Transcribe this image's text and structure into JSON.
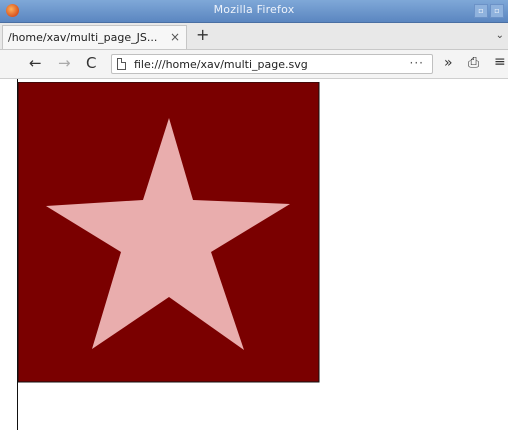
{
  "window": {
    "title": "Mozilla Firefox",
    "controls": [
      "▫",
      "▫"
    ]
  },
  "tabs": [
    {
      "label": "/home/xav/multi_page_JS...",
      "close": "×",
      "active": true
    }
  ],
  "tabstrip": {
    "new_tab": "+",
    "overflow": "⌄"
  },
  "navbar": {
    "back": "←",
    "forward": "→",
    "reload": "C",
    "url": "file:///home/xav/multi_page.svg",
    "page_actions": "···",
    "overflow": "»",
    "library": "⎙",
    "menu": "≡"
  },
  "content": {
    "background_color": "#7a0000",
    "star_color": "#e9adad",
    "border_color": "#111111"
  }
}
